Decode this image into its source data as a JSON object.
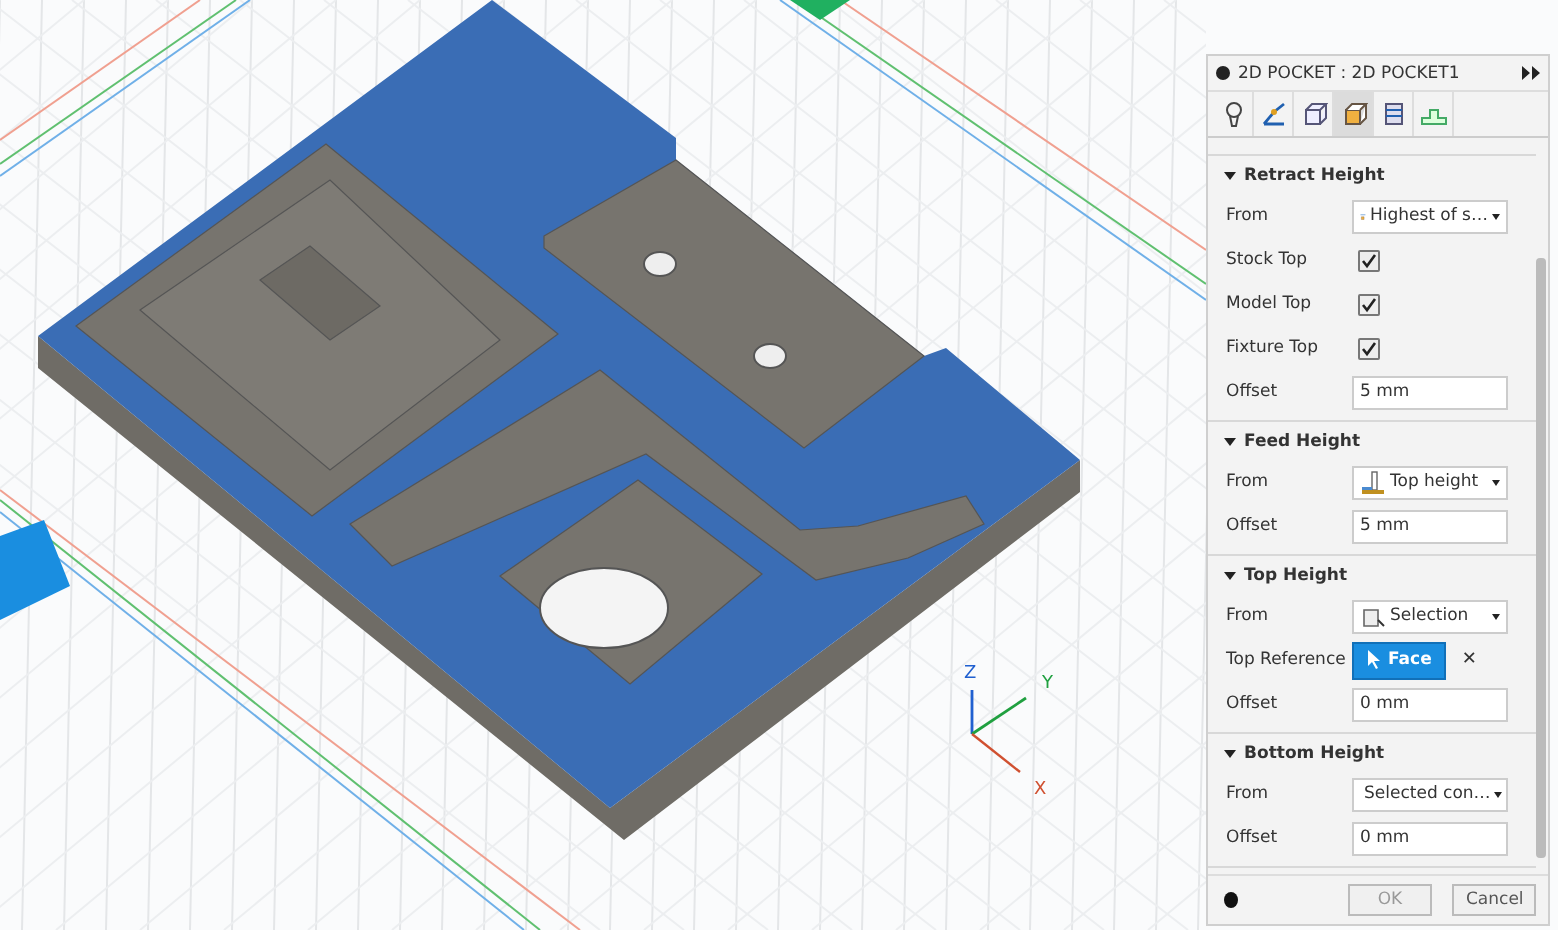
{
  "panel": {
    "title": "2D POCKET : 2D POCKET1",
    "tabs": [
      {
        "selected": false
      },
      {
        "selected": false
      },
      {
        "selected": false
      },
      {
        "selected": true
      },
      {
        "selected": false
      },
      {
        "selected": false
      }
    ],
    "sections": [
      {
        "title": "Retract Height",
        "expanded": true,
        "rows": [
          {
            "kind": "select",
            "label": "From",
            "value": "Highest of s…"
          },
          {
            "kind": "checkbox",
            "label": "Stock Top",
            "checked": true
          },
          {
            "kind": "checkbox",
            "label": "Model Top",
            "checked": true
          },
          {
            "kind": "checkbox",
            "label": "Fixture Top",
            "checked": true
          },
          {
            "kind": "text",
            "label": "Offset",
            "value": "5 mm"
          }
        ]
      },
      {
        "title": "Feed Height",
        "expanded": true,
        "rows": [
          {
            "kind": "select",
            "label": "From",
            "value": "Top height"
          },
          {
            "kind": "text",
            "label": "Offset",
            "value": "5 mm"
          }
        ]
      },
      {
        "title": "Top Height",
        "expanded": true,
        "rows": [
          {
            "kind": "select",
            "label": "From",
            "value": "Selection"
          },
          {
            "kind": "selection",
            "label": "Top Reference",
            "value": "Face",
            "clear": "✕"
          },
          {
            "kind": "text",
            "label": "Offset",
            "value": "0 mm"
          }
        ]
      },
      {
        "title": "Bottom Height",
        "expanded": true,
        "rows": [
          {
            "kind": "select",
            "label": "From",
            "value": "Selected con…"
          },
          {
            "kind": "text",
            "label": "Offset",
            "value": "0 mm"
          }
        ]
      }
    ],
    "ok": "OK",
    "cancel": "Cancel"
  },
  "axes": {
    "z": "Z",
    "y": "Y",
    "x": "X"
  }
}
